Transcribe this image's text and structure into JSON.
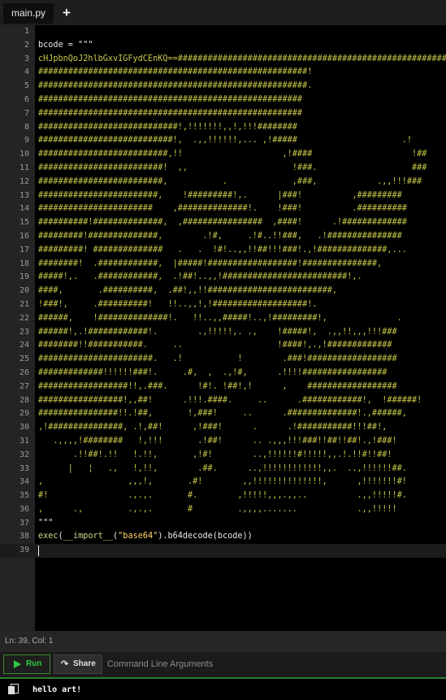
{
  "tab": {
    "name": "main.py",
    "add_label": "+"
  },
  "editor": {
    "lines": [
      "",
      "bcode = \"\"\"",
      "cHJpbnQoJ2hlbGxvIGFydCEnKQ==###########################################################",
      "######################################################!",
      "######################################################.",
      "#####################################################",
      "#####################################################",
      "############################!,!!!!!!!,,!,!!!########",
      "###########################!,  .,,!!!!!!,... ,!#####                     .!",
      "##########################,!!                    ,!####                    !##",
      "#########################!  ,,                     !###.                   ###",
      "#########################,           .             ,###,            .,,!!!###",
      "########################,    !#########!,.      |###!          ,#########",
      "#######################    ,##############!.    !###!          .##########",
      "##########!##############,  ,################  ,####!      .!#############",
      "#########!##############,        .!#,     .!#..!!###,   .!###############",
      "#########! ##############   .   .  !#!..,,!!##!!!###!.,!##############,...",
      "########!  .############,  |#####!##################!###############,",
      "#####!,.   .############,  .!##!..,,!#########################!,.",
      "####,       .##########,  .##!,,!!#########################,",
      "!###!,     .##########!   !!..,,!,!###################!.",
      "######,    !##############!.   !!..,,#####!..,!#########!,              .",
      "######!,.!############!.        .,!!!!!,. .,    !#####!,  .,,!!,,,!!!###",
      "########!!###########.     ..                   !####!,.,!#############",
      "#######################.   .!           !        .###!##################",
      "#############!!!!!!###!.     .#,  ,  .,!#,      .!!!!#################",
      "##################!!,.###.      !#!. !##!,!      ,    ##################",
      "#################!,,##!      .!!!.####.     ..      .############!,  !######!",
      "################!!.!##,       !,###!     ..      .##############!.,######,",
      ",!###############, .!,##!      ,!###!      .      .!###########!!!##!,",
      "   .,,,,!########   !,!!!       .!##!      .. .,,,!!!###!!##!!##!.,!###!",
      "       .!!##!.!!   !.!!,       ,!#!        ..,!!!!!!#!!!!!,,.!.!!#!!##!",
      "      |   ¦   .,   !,!!,        .##.      ..,!!!!!!!!!!!!,,.  ..,!!!!!!##.",
      ",                 ,,,!,       .#!        ,,!!!!!!!!!!!!!!,      ,!!!!!!!#!",
      "#!                .,.,.       #.        ,!!!!!,,,.,,..          .,,!!!!!#.",
      ",      .,         .,.,.       #         .,,,,.......            .,,!!!!!",
      "\"\"\"",
      "exec(__import__(\"base64\").b64decode(bcode))",
      ""
    ],
    "active_line": 39
  },
  "status": {
    "text": "Ln: 39,  Col: 1"
  },
  "toolbar": {
    "run_label": "Run",
    "share_label": "Share",
    "args_placeholder": "Command Line Arguments"
  },
  "output": {
    "text": "hello art!"
  }
}
